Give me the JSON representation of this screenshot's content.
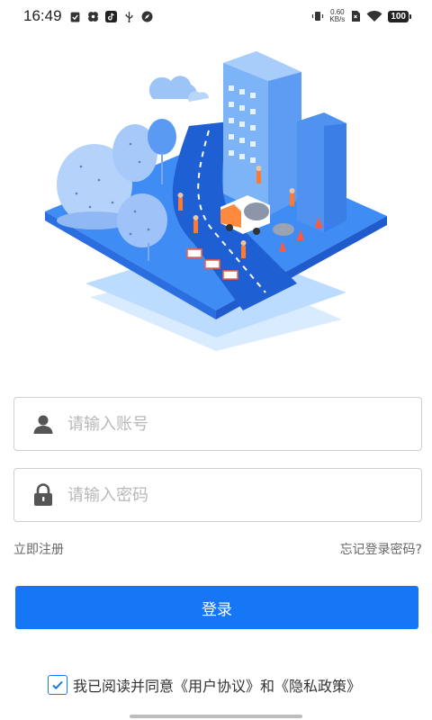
{
  "status_bar": {
    "time": "16:49",
    "net_speed_value": "0.60",
    "net_speed_unit": "KB/s",
    "battery": "100"
  },
  "login": {
    "account_placeholder": "请输入账号",
    "password_placeholder": "请输入密码",
    "register_link": "立即注册",
    "forgot_password_link": "忘记登录密码?",
    "login_button": "登录"
  },
  "agreement": {
    "checked": true,
    "prefix": "我已阅读并同意",
    "user_agreement": "《用户协议》",
    "conjunction": "和",
    "privacy_policy": "《隐私政策》"
  },
  "colors": {
    "primary": "#1677f6",
    "border": "#cfcfcf",
    "placeholder": "#b8b8b8"
  }
}
